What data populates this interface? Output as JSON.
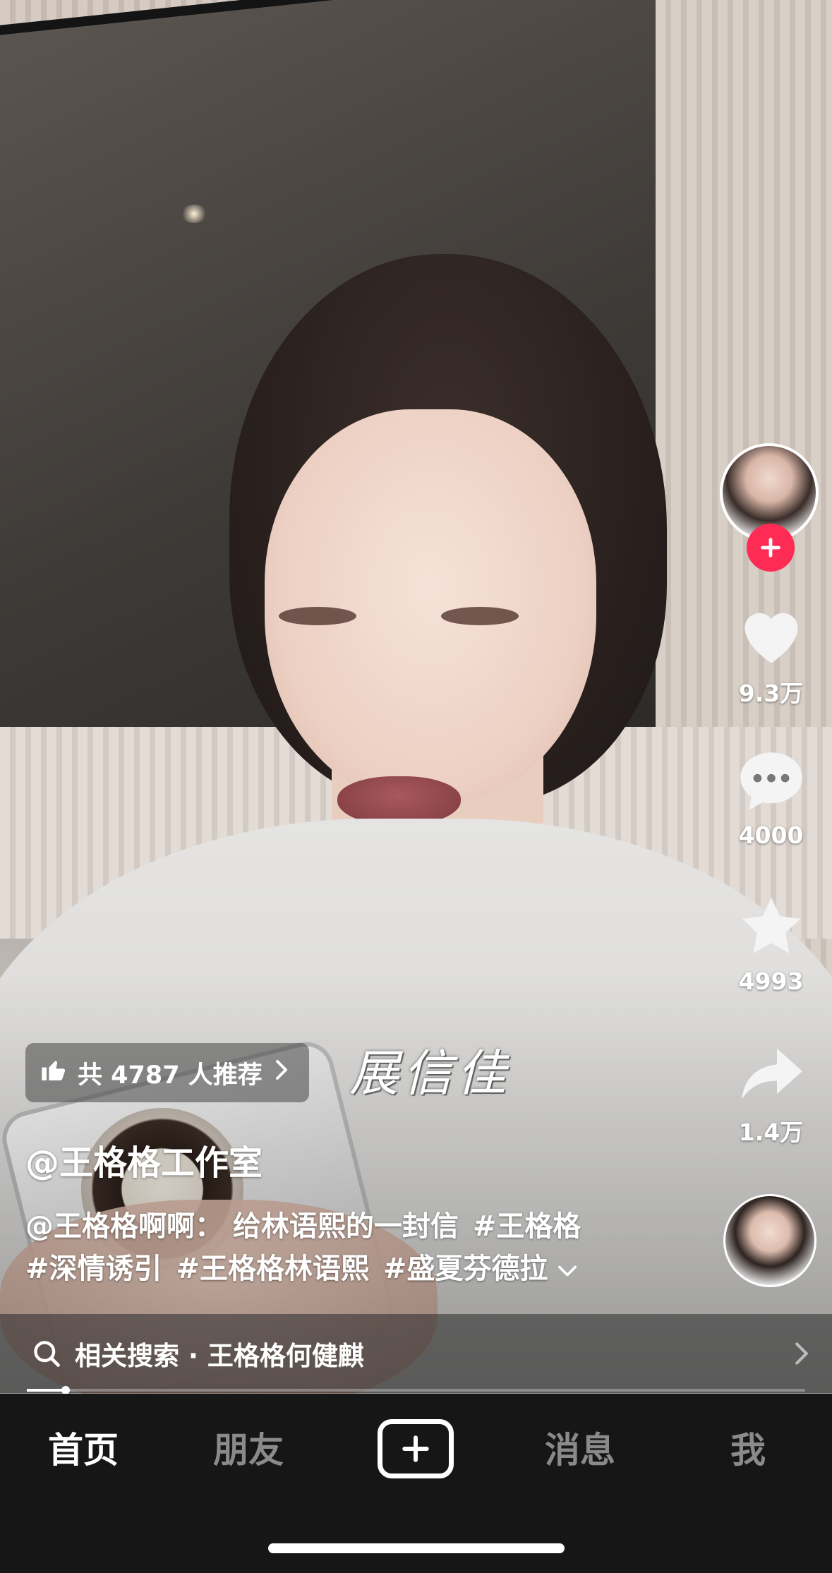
{
  "video": {
    "watermark_text": "展信佳",
    "progress": 0.05
  },
  "recommend": {
    "icon": "thumbs-up-icon",
    "label": "共 4787 人推荐"
  },
  "post": {
    "author": "@王格格工作室",
    "caption_text": "@王格格啊啊： 给林语熙的一封信",
    "hashtags": [
      "#王格格",
      "#深情诱引",
      "#王格格林语熙",
      "#盛夏芬德拉"
    ],
    "expand_icon": "chevron-down-icon"
  },
  "related_search": {
    "label": "相关搜索 · 王格格何健麒",
    "icon": "search-icon"
  },
  "rail": {
    "like_count": "9.3万",
    "comment_count": "4000",
    "favorite_count": "4993",
    "share_count": "1.4万",
    "accent_color": "#fe2c55"
  },
  "tabbar": {
    "tabs": [
      "首页",
      "朋友",
      "消息",
      "我"
    ],
    "active": "首页"
  }
}
